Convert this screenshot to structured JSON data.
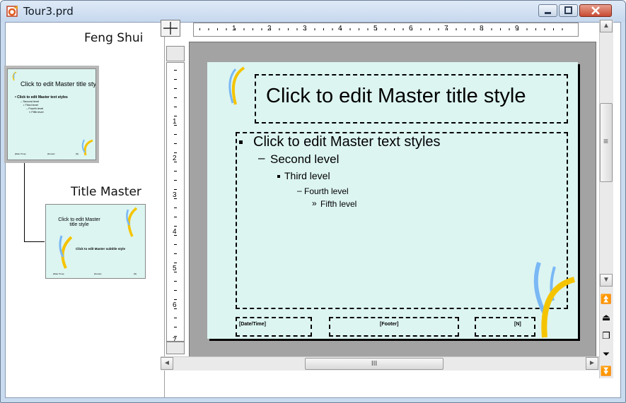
{
  "window": {
    "title": "Tour3.prd"
  },
  "left_pane": {
    "masters": [
      {
        "label": "Feng Shui"
      },
      {
        "label": "Title Master"
      }
    ],
    "master_thumb": {
      "title": "Click to edit Master title style",
      "levels": [
        "• Click to edit Master text styles",
        "– Second level",
        "• Third level",
        "– Fourth level",
        "» Fifth level"
      ],
      "footer": [
        "[Date Time]",
        "[Footer]",
        "[N]"
      ]
    },
    "title_thumb": {
      "title": "Click to edit Master title style",
      "subtitle": "Click to edit Master subtitle style",
      "footer": [
        "[Date Time]",
        "[Footer]",
        "[N]"
      ]
    }
  },
  "ruler": {
    "horizontal_labels": [
      "1",
      "2",
      "3",
      "4",
      "5",
      "6",
      "7",
      "8",
      "9"
    ],
    "vertical_labels": [
      "1",
      "2",
      "3",
      "4",
      "5",
      "6",
      "7"
    ]
  },
  "slide": {
    "title": "Click to edit Master title style",
    "body": {
      "level1": "Click to edit Master text styles",
      "level2": "Second level",
      "level3": "Third level",
      "level4": "Fourth level",
      "level5": "Fifth level"
    },
    "footer": {
      "date_time": "[Date/Time]",
      "footer": "[Footer]",
      "number": "[N]"
    },
    "background_color": "#dcf5f1",
    "accent_colors": [
      "#f5c400",
      "#7ab8f5"
    ]
  },
  "scrollbars": {
    "hthumb_grip": "III",
    "vthumb_grip": "≡"
  },
  "icons": [
    "app-icon",
    "minimize-icon",
    "maximize-icon",
    "close-icon",
    "scroll-up-icon",
    "scroll-down-icon",
    "scroll-left-icon",
    "scroll-right-icon",
    "first-slide-icon",
    "previous-slide-icon",
    "slide-view-icon",
    "next-slide-icon",
    "last-slide-icon",
    "ruler-corner-icon"
  ]
}
